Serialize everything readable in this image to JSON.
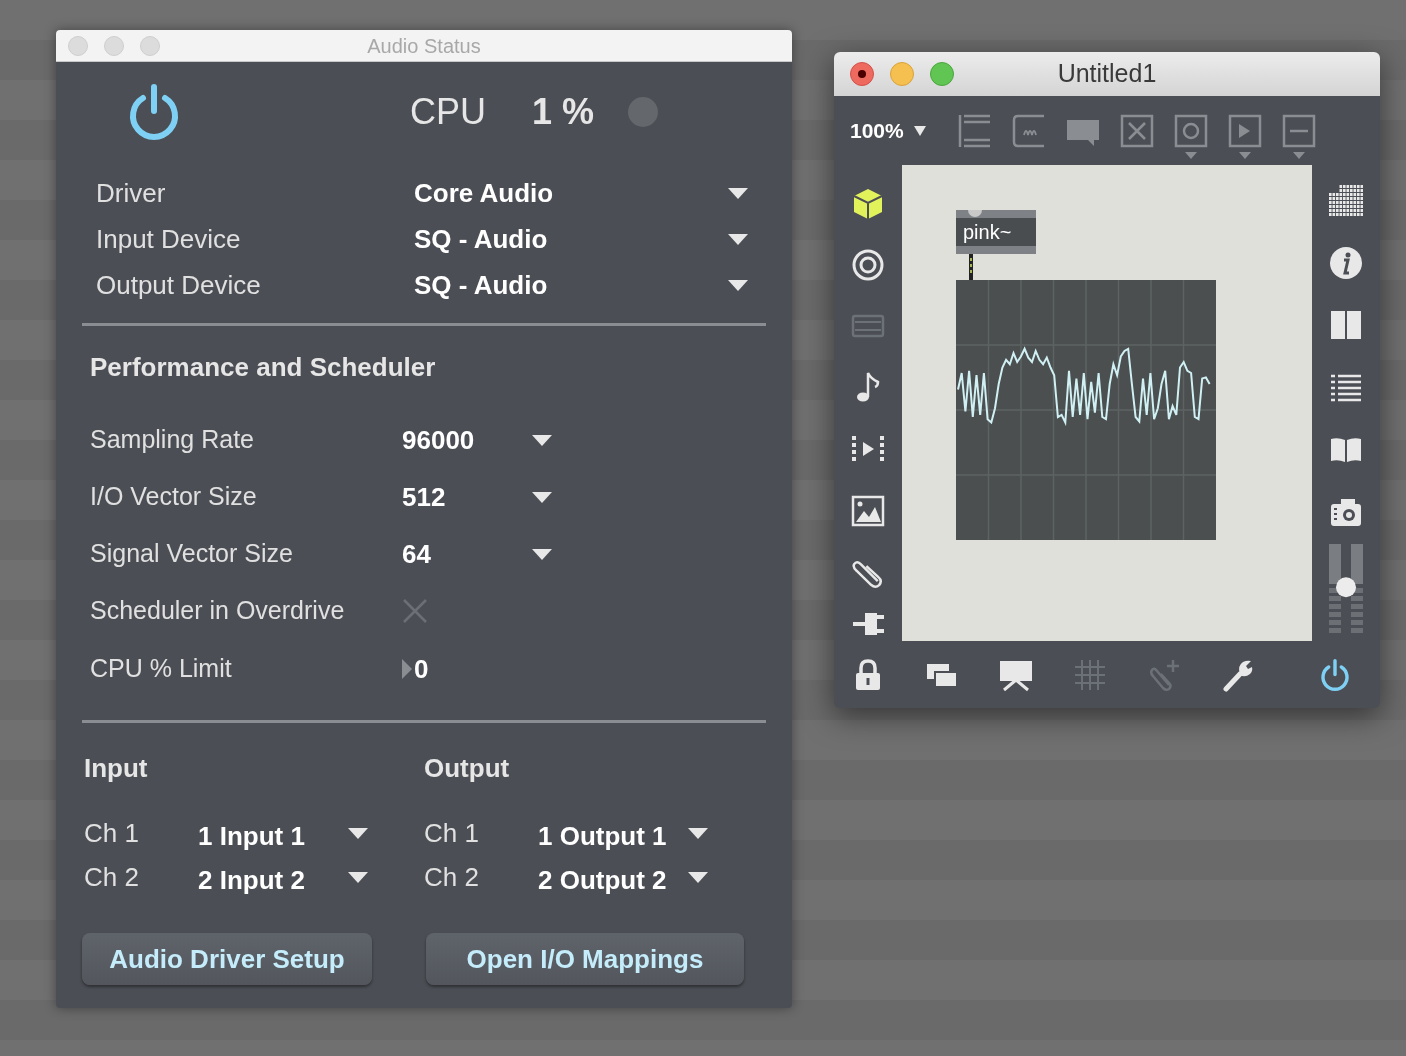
{
  "audio_status": {
    "title": "Audio Status",
    "power_on": true,
    "cpu_label": "CPU",
    "cpu_value": "1 %",
    "cpu_overload": false,
    "devices": [
      {
        "label": "Driver",
        "value": "Core Audio"
      },
      {
        "label": "Input Device",
        "value": "SQ - Audio"
      },
      {
        "label": "Output Device",
        "value": "SQ - Audio"
      }
    ],
    "section_title": "Performance and Scheduler",
    "settings": [
      {
        "kind": "dropdown",
        "label": "Sampling Rate",
        "value": "96000"
      },
      {
        "kind": "dropdown",
        "label": "I/O Vector Size",
        "value": "512"
      },
      {
        "kind": "dropdown",
        "label": "Signal Vector Size",
        "value": "64"
      },
      {
        "kind": "checkbox",
        "label": "Scheduler in Overdrive",
        "checked": false
      },
      {
        "kind": "number",
        "label": "CPU % Limit",
        "value": "0"
      }
    ],
    "io": [
      {
        "title": "Input",
        "channels": [
          {
            "label": "Ch 1",
            "value": "1 Input 1"
          },
          {
            "label": "Ch 2",
            "value": "2 Input 2"
          }
        ]
      },
      {
        "title": "Output",
        "channels": [
          {
            "label": "Ch 1",
            "value": "1 Output 1"
          },
          {
            "label": "Ch 2",
            "value": "2 Output 2"
          }
        ]
      }
    ],
    "buttons": [
      "Audio Driver Setup",
      "Open I/O Mappings"
    ]
  },
  "patcher": {
    "title": "Untitled1",
    "zoom": "100%",
    "object": "pink~",
    "dsp_on": true,
    "volume": {
      "level": 0.55
    }
  }
}
